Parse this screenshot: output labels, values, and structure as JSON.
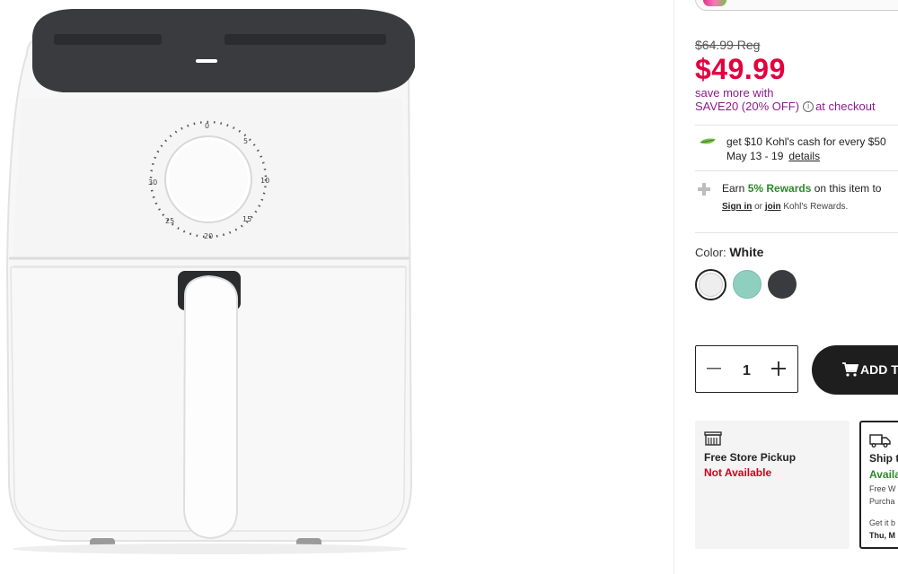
{
  "product": {
    "image_alt": "White air fryer"
  },
  "pricing": {
    "regular": "$64.99 Reg",
    "sale": "$49.99",
    "promo_line1": "save more with",
    "promo_code": "SAVE20 (20% OFF)",
    "promo_suffix": "at checkout",
    "info_glyph": "i"
  },
  "kohls_cash": {
    "line1": "get $10 Kohl's cash for every $50",
    "dates": "May 13 - 19",
    "details_link": "details"
  },
  "rewards": {
    "earn_prefix": "Earn",
    "earn_rate": "5% Rewards",
    "earn_suffix": "on this item to",
    "sign_in": "Sign in",
    "or": "or",
    "join": "join",
    "suffix": "Kohl's Rewards."
  },
  "color": {
    "label": "Color:",
    "selected": "White",
    "swatches": [
      {
        "name": "White",
        "hex": "#eeeeee"
      },
      {
        "name": "Aqua",
        "hex": "#8fcfc0"
      },
      {
        "name": "Black",
        "hex": "#3a3b3e"
      }
    ]
  },
  "quantity": {
    "value": "1"
  },
  "add_to_cart": {
    "label": "ADD T"
  },
  "pickup": {
    "title": "Free Store Pickup",
    "status": "Not Available"
  },
  "ship": {
    "title": "Ship t",
    "status": "Availa",
    "line1": "Free W",
    "line2": "Purcha",
    "line3": "Get it b",
    "line4": "Thu, M"
  },
  "colors": {
    "sale_red": "#e3003e",
    "promo_purple": "#8b1d8f",
    "rewards_green": "#2d8a2a",
    "unavailable_red": "#d4001c"
  }
}
